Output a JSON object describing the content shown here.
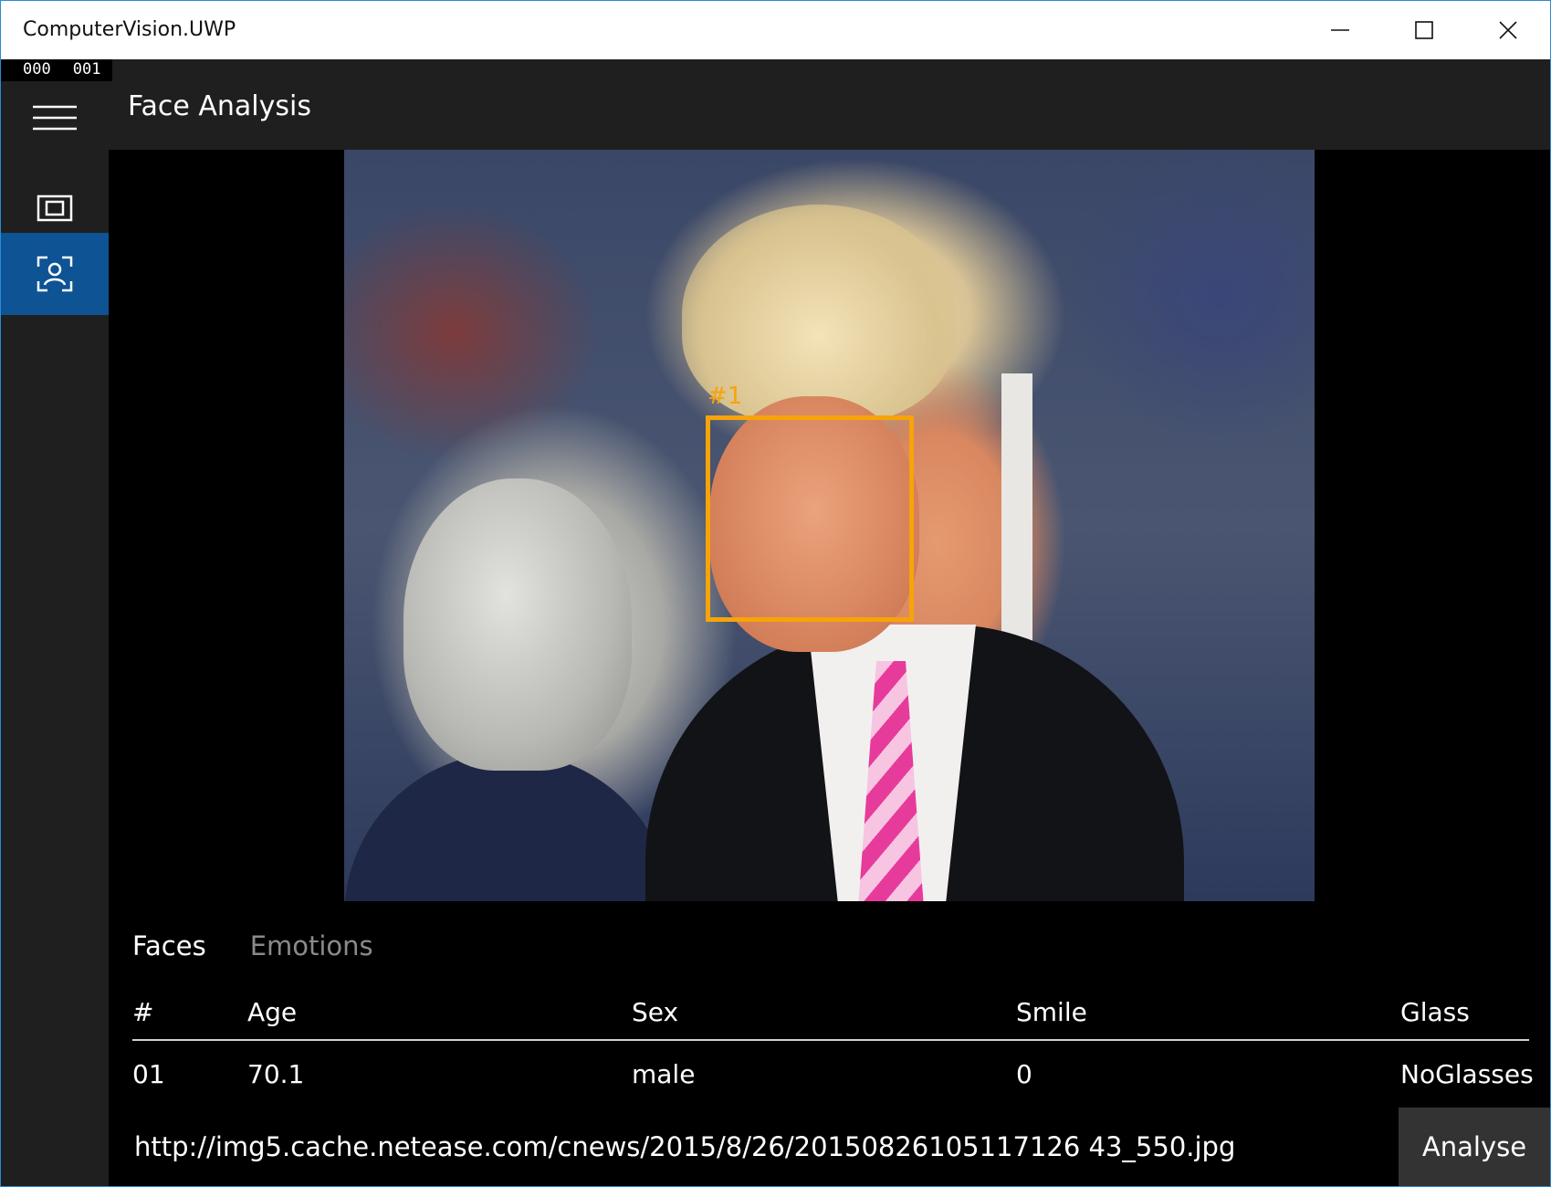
{
  "window": {
    "title": "ComputerVision.UWP"
  },
  "debug": {
    "counter_left": "000",
    "counter_right": "001"
  },
  "header": {
    "title": "Face Analysis"
  },
  "face_box": {
    "label": "#1",
    "color": "#f7a30a"
  },
  "tabs": [
    {
      "label": "Faces",
      "active": true
    },
    {
      "label": "Emotions",
      "active": false
    }
  ],
  "table": {
    "columns": [
      "#",
      "Age",
      "Sex",
      "Smile",
      "Glass"
    ],
    "rows": [
      [
        "01",
        "70.1",
        "male",
        "0",
        "NoGlasses"
      ]
    ]
  },
  "input": {
    "url": "http://img5.cache.netease.com/cnews/2015/8/26/20150826105117126 43_550.jpg"
  },
  "actions": {
    "analyse_label": "Analyse"
  },
  "theme": {
    "accent": "#0e5394",
    "nav_bg": "#1f1f1f",
    "border": "#2b8ad4"
  }
}
